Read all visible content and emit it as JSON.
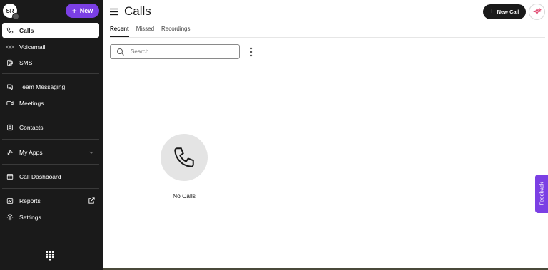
{
  "sidebar": {
    "avatar_initials": "SR",
    "new_button_label": "New",
    "items": [
      {
        "label": "Calls",
        "icon": "phone-icon"
      },
      {
        "label": "Voicemail",
        "icon": "voicemail-icon"
      },
      {
        "label": "SMS",
        "icon": "sms-icon"
      },
      {
        "label": "Team Messaging",
        "icon": "chat-icon"
      },
      {
        "label": "Meetings",
        "icon": "video-icon"
      },
      {
        "label": "Contacts",
        "icon": "contacts-icon"
      },
      {
        "label": "My Apps",
        "icon": "apps-icon"
      },
      {
        "label": "Call Dashboard",
        "icon": "dashboard-icon"
      },
      {
        "label": "Reports",
        "icon": "reports-icon"
      },
      {
        "label": "Settings",
        "icon": "gear-icon"
      }
    ],
    "active_item": "Calls"
  },
  "header": {
    "title": "Calls",
    "new_call_label": "New Call"
  },
  "tabs": [
    {
      "label": "Recent",
      "active": true
    },
    {
      "label": "Missed",
      "active": false
    },
    {
      "label": "Recordings",
      "active": false
    }
  ],
  "search": {
    "placeholder": "Search",
    "value": ""
  },
  "empty_state": {
    "text": "No Calls",
    "icon": "phone-icon"
  },
  "feedback_label": "Feedback",
  "colors": {
    "sidebar_bg": "#1a1a1a",
    "accent": "#7b3fe4",
    "primary_button": "#1a1a1a"
  }
}
